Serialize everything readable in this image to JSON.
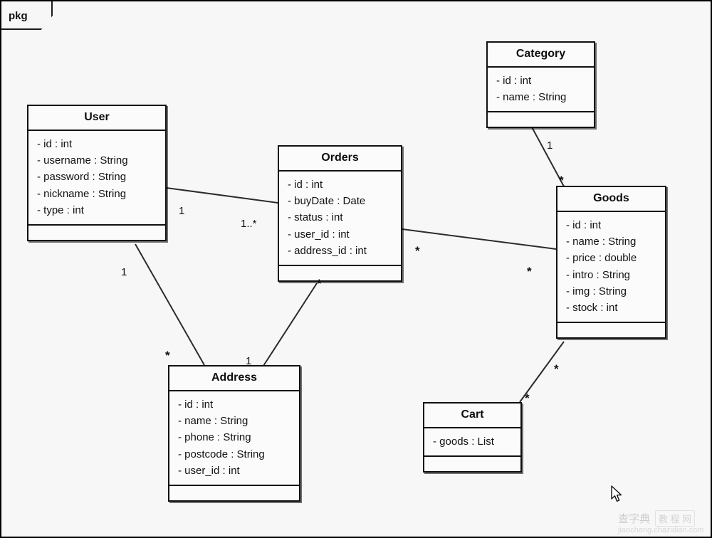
{
  "diagram": {
    "package_label": "pkg",
    "type": "uml-class-diagram",
    "classes": [
      {
        "id": "user",
        "name": "User",
        "attributes": [
          "- id : int",
          "- username : String",
          "- password : String",
          "- nickname : String",
          "- type : int"
        ],
        "operations": []
      },
      {
        "id": "orders",
        "name": "Orders",
        "attributes": [
          "- id : int",
          "- buyDate : Date",
          "- status : int",
          "- user_id : int",
          "- address_id : int"
        ],
        "operations": []
      },
      {
        "id": "category",
        "name": "Category",
        "attributes": [
          "- id : int",
          "- name : String"
        ],
        "operations": []
      },
      {
        "id": "goods",
        "name": "Goods",
        "attributes": [
          "- id : int",
          "- name : String",
          "- price : double",
          "- intro : String",
          "- img : String",
          "- stock : int"
        ],
        "operations": []
      },
      {
        "id": "address",
        "name": "Address",
        "attributes": [
          "- id : int",
          "- name : String",
          "- phone : String",
          "- postcode : String",
          "- user_id : int"
        ],
        "operations": []
      },
      {
        "id": "cart",
        "name": "Cart",
        "attributes": [
          "- goods : List"
        ],
        "operations": []
      }
    ],
    "associations": [
      {
        "id": "user-orders",
        "from": "user",
        "to": "orders",
        "from_multiplicity": "1",
        "to_multiplicity": "1..*"
      },
      {
        "id": "user-address",
        "from": "user",
        "to": "address",
        "from_multiplicity": "1",
        "to_multiplicity": "*"
      },
      {
        "id": "orders-address",
        "from": "orders",
        "to": "address",
        "from_multiplicity": "*",
        "to_multiplicity": "1"
      },
      {
        "id": "orders-goods",
        "from": "orders",
        "to": "goods",
        "from_multiplicity": "*",
        "to_multiplicity": "*"
      },
      {
        "id": "category-goods",
        "from": "category",
        "to": "goods",
        "from_multiplicity": "1",
        "to_multiplicity": "*"
      },
      {
        "id": "goods-cart",
        "from": "goods",
        "to": "cart",
        "from_multiplicity": "*",
        "to_multiplicity": "*"
      }
    ],
    "multiplicity_labels": {
      "user_orders_user": "1",
      "user_orders_orders": "1..*",
      "user_address_user": "1",
      "user_address_address": "*",
      "orders_address_orders": "*",
      "orders_address_address": "1",
      "orders_goods_orders": "*",
      "orders_goods_goods": "*",
      "category_goods_category": "1",
      "category_goods_goods": "*",
      "goods_cart_goods": "*",
      "goods_cart_cart": "*"
    }
  },
  "watermark": {
    "cn_text": "查字典",
    "badge_text": "教 程 网",
    "url": "jiaocheng.chazidian.com"
  },
  "colors": {
    "canvas_bg": "#f7f7f7",
    "class_bg": "#fbfbfb",
    "stroke": "#111111",
    "link": "#2b2b2b"
  }
}
